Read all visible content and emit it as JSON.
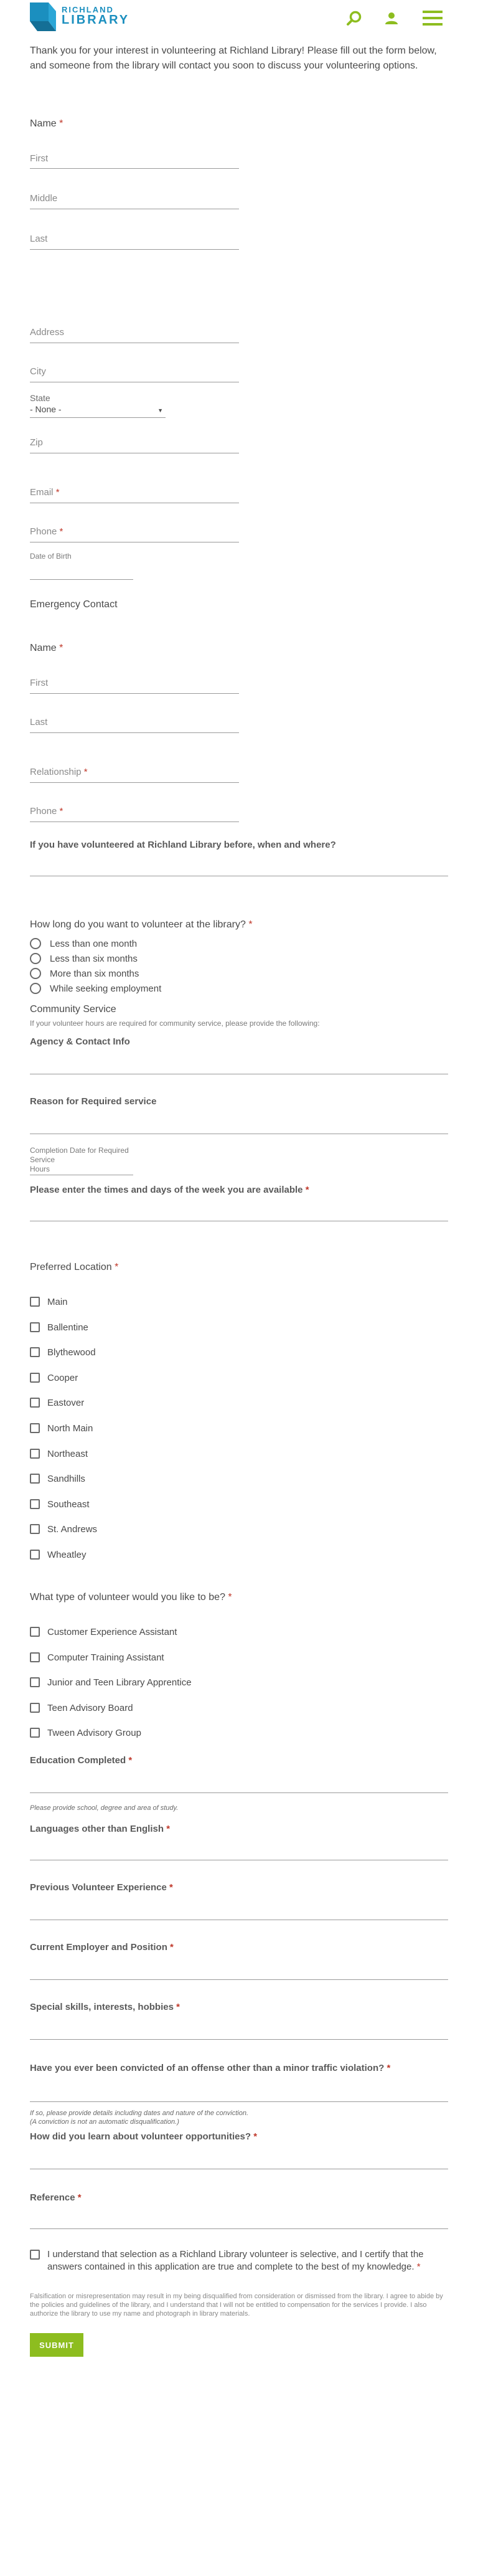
{
  "header": {
    "logo_line1": "RICHLAND",
    "logo_line2": "LIBRARY",
    "icons": [
      "search-icon",
      "user-icon",
      "menu-icon"
    ],
    "colors": {
      "brand_blue": "#1b8fbf",
      "accent_green": "#8dbd1f",
      "required_red": "#c0392b"
    }
  },
  "intro": "Thank you for your interest in volunteering at Richland Library! Please fill out the form below, and someone from the library will contact you soon to discuss your volunteering options.",
  "name": {
    "label": "Name",
    "first": "First",
    "middle": "Middle",
    "last": "Last"
  },
  "address": {
    "address": "Address",
    "city": "City",
    "state_label": "State",
    "state_value": "- None -",
    "zip": "Zip"
  },
  "contact": {
    "email": "Email",
    "phone": "Phone",
    "dob": "Date of Birth"
  },
  "emergency": {
    "heading": "Emergency Contact",
    "name_label": "Name",
    "first": "First",
    "last": "Last",
    "relationship": "Relationship",
    "phone": "Phone"
  },
  "prior": {
    "label": "If you have volunteered at Richland Library before, when and where?"
  },
  "duration": {
    "label": "How long do you want to volunteer at the library?",
    "options": [
      "Less than one month",
      "Less than six months",
      "More than six months",
      "While seeking employment"
    ]
  },
  "community": {
    "heading": "Community Service",
    "desc": "If your volunteer hours are required for community service, please provide the following:",
    "agency": "Agency & Contact Info",
    "reason": "Reason for Required service",
    "completion": "Completion Date for Required Service",
    "hours": "Hours"
  },
  "times": {
    "label": "Please enter the times and days of the week you are available"
  },
  "locations": {
    "label": "Preferred Location",
    "options": [
      "Main",
      "Ballentine",
      "Blythewood",
      "Cooper",
      "Eastover",
      "North Main",
      "Northeast",
      "Sandhills",
      "Southeast",
      "St. Andrews",
      "Wheatley"
    ]
  },
  "types": {
    "label": "What type of volunteer would you like to be?",
    "options": [
      "Customer Experience Assistant",
      "Computer Training Assistant",
      "Junior and Teen Library Apprentice",
      "Teen Advisory Board",
      "Tween Advisory Group"
    ]
  },
  "education": {
    "label": "Education Completed",
    "helper": "Please provide school, degree and area of study."
  },
  "languages": {
    "label": "Languages other than English"
  },
  "experience": {
    "label": "Previous Volunteer Experience"
  },
  "employer": {
    "label": "Current Employer and Position"
  },
  "skills": {
    "label": "Special skills, interests, hobbies"
  },
  "conviction": {
    "label": "Have you ever been convicted of an offense other than a minor traffic violation?",
    "helper1": "If so, please provide details including dates and nature of the conviction.",
    "helper2": "(A conviction is not an automatic disqualification.)"
  },
  "learned": {
    "label": "How did you learn about volunteer opportunities?"
  },
  "reference": {
    "label": "Reference"
  },
  "agreement": {
    "text": "I understand that selection as a Richland Library volunteer is selective, and I certify that the answers contained in this application are true and complete to the best of my knowledge.",
    "fine": "Falsification or misrepresentation may result in my being disqualified from consideration or dismissed from the library. I agree to abide by the policies and guidelines of the library, and I understand that I will not be entitled to compensation for the services I provide. I also authorize the library to use my name and photograph in library materials."
  },
  "submit": "SUBMIT",
  "required_mark": "*"
}
